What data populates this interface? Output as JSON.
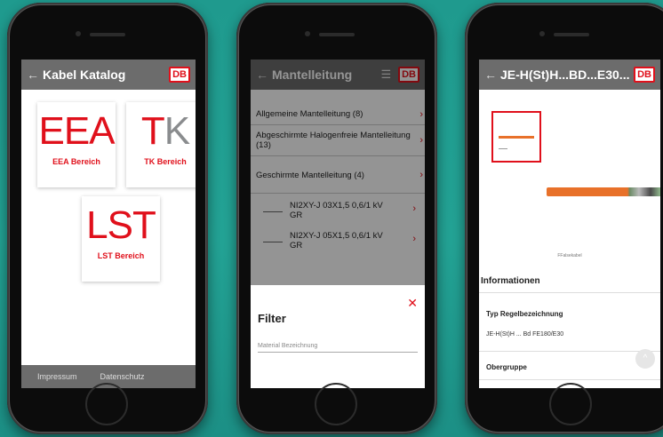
{
  "colors": {
    "db_red": "#e0101b",
    "appbar": "#6c6c6c",
    "background": "#1f9a8e"
  },
  "phone1": {
    "title": "Kabel Katalog",
    "db_logo": "DB",
    "tiles": [
      {
        "abbr_red": "E",
        "abbr_gray": "EA",
        "label": "EEA Bereich"
      },
      {
        "abbr_red": "T",
        "abbr_gray": "K",
        "label": "TK Bereich"
      },
      {
        "abbr_red": "L",
        "abbr_gray": "ST",
        "label": "LST Bereich"
      }
    ],
    "footer": {
      "impressum": "Impressum",
      "datenschutz": "Datenschutz"
    }
  },
  "phone2": {
    "title": "Mantelleitung",
    "db_logo": "DB",
    "categories": [
      "Allgemeine Mantelleitung (8)",
      "Abgeschirmte Halogenfreie Mantelleitung (13)",
      "Geschirmte Mantelleitung (4)"
    ],
    "items": [
      "NI2XY-J 03X1,5 0,6/1 kV GR",
      "NI2XY-J 05X1,5 0,6/1 kV GR"
    ],
    "filter": {
      "title": "Filter",
      "placeholder": "Material Bezeichnung"
    }
  },
  "phone3": {
    "title": "JE-H(St)H...BD...E30...",
    "db_logo": "DB",
    "image_caption": "FFalsekabel",
    "info_heading": "Informationen",
    "typ_label": "Typ Regelbezeichnung",
    "typ_value": "JE-H(St)H ... Bd FE180/E30",
    "obergruppe_label": "Obergruppe"
  }
}
